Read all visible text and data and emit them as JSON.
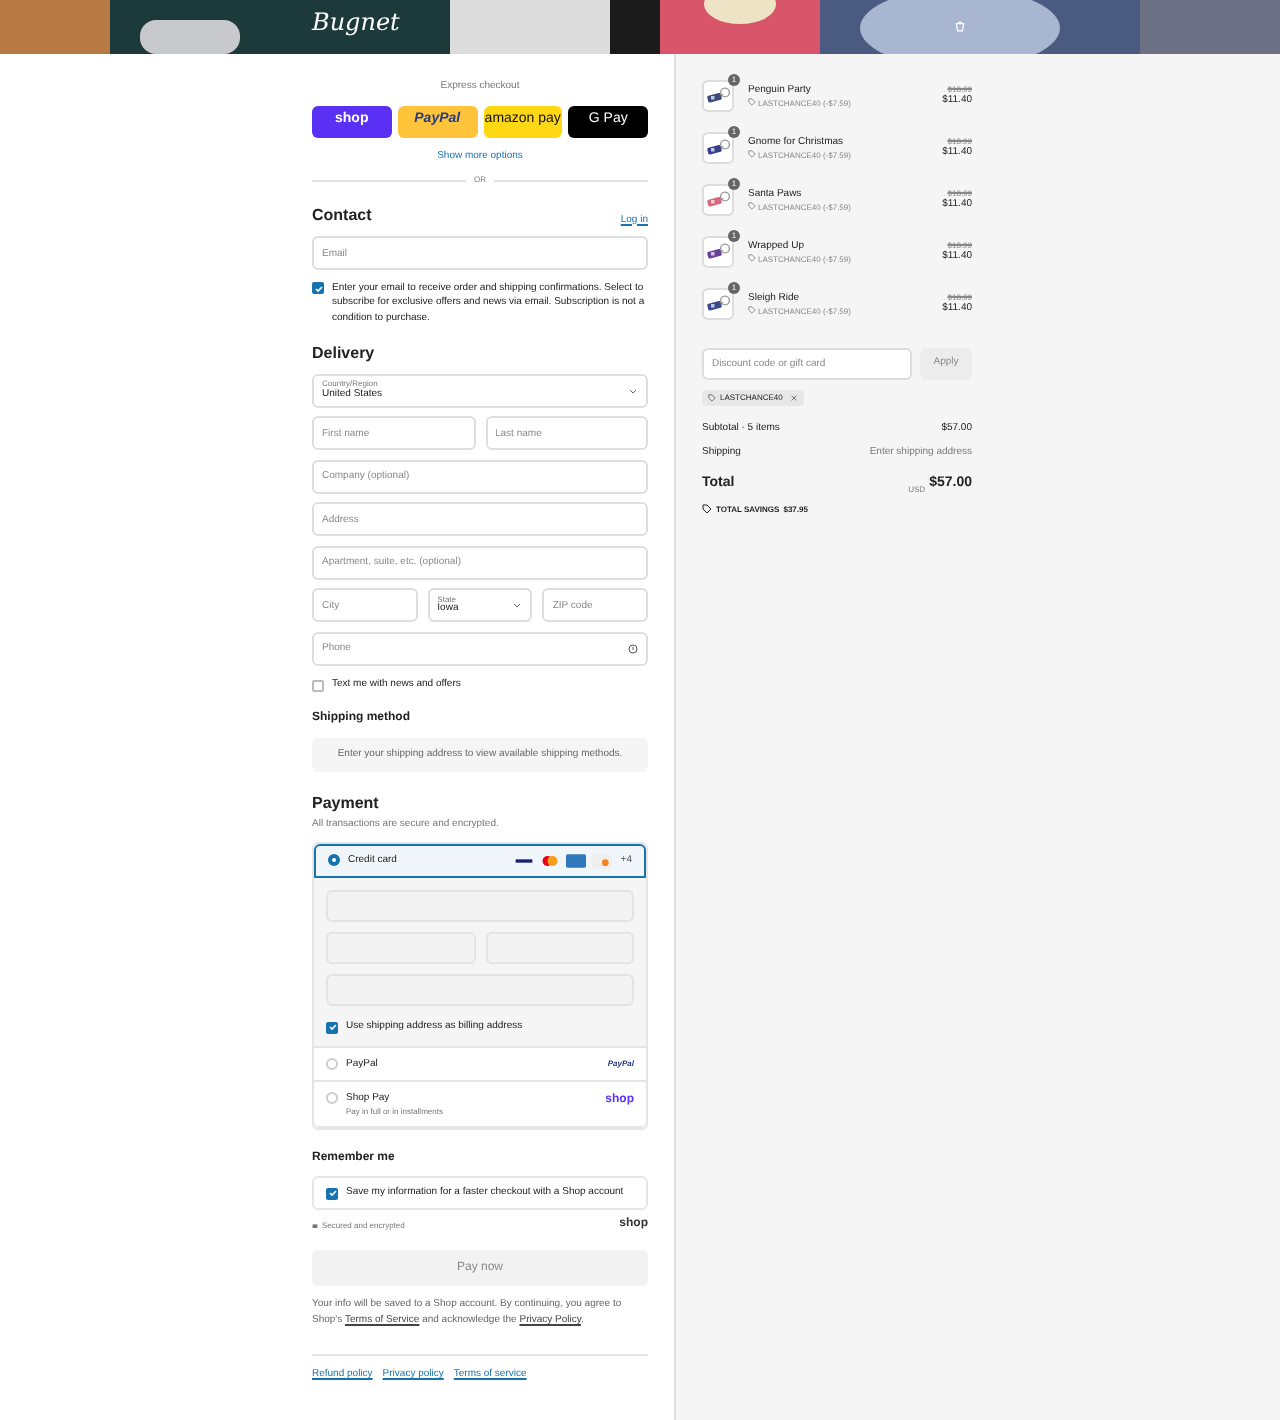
{
  "header": {
    "logo": "Bugnet"
  },
  "express": {
    "label": "Express checkout",
    "buttons": [
      {
        "kind": "shop",
        "label": "shop"
      },
      {
        "kind": "paypal",
        "label": "PayPal"
      },
      {
        "kind": "amazon",
        "label": "amazon pay"
      },
      {
        "kind": "gpay",
        "label": "G Pay"
      }
    ],
    "more": "Show more options",
    "or": "OR"
  },
  "contact": {
    "title": "Contact",
    "login": "Log in",
    "email": {
      "placeholder": "Email"
    },
    "subscribe": {
      "checked": true,
      "text": "Enter your email to receive order and shipping confirmations. Select to subscribe for exclusive offers and news via email. Subscription is not a condition to purchase."
    }
  },
  "delivery": {
    "title": "Delivery",
    "rows": [
      [
        {
          "kind": "select",
          "label": "Country/Region",
          "value": "United States"
        }
      ],
      [
        {
          "kind": "text",
          "placeholder": "First name"
        },
        {
          "kind": "text",
          "placeholder": "Last name"
        }
      ],
      [
        {
          "kind": "text",
          "placeholder": "Company (optional)"
        }
      ],
      [
        {
          "kind": "text",
          "placeholder": "Address"
        }
      ],
      [
        {
          "kind": "text",
          "placeholder": "Apartment, suite, etc. (optional)"
        }
      ],
      [
        {
          "kind": "text",
          "placeholder": "City"
        },
        {
          "kind": "select",
          "label": "State",
          "value": "Iowa"
        },
        {
          "kind": "text",
          "placeholder": "ZIP code"
        }
      ],
      [
        {
          "kind": "phone",
          "placeholder": "Phone"
        }
      ]
    ],
    "sms": {
      "checked": false,
      "text": "Text me with news and offers"
    }
  },
  "shipping": {
    "title": "Shipping method",
    "note": "Enter your shipping address to view available shipping methods."
  },
  "payment": {
    "title": "Payment",
    "subtitle": "All transactions are secure and encrypted.",
    "methods": [
      {
        "kind": "card",
        "label": "Credit card",
        "selected": true,
        "more": "+4",
        "billing": {
          "checked": true,
          "text": "Use shipping address as billing address"
        }
      },
      {
        "kind": "paypal",
        "label": "PayPal",
        "logo": "PayPal",
        "selected": false
      },
      {
        "kind": "shoppay",
        "label": "Shop Pay",
        "sub": "Pay in full or in installments",
        "logo": "shop",
        "selected": false
      }
    ]
  },
  "remember": {
    "title": "Remember me",
    "save": {
      "checked": true,
      "text": "Save my information for a faster checkout with a Shop account"
    },
    "secure": "Secured and encrypted",
    "logo": "shop"
  },
  "pay": {
    "label": "Pay now",
    "disabled": true
  },
  "info": "Your info will be saved to a Shop account. By continuing, you agree to Shop's",
  "info_link1": "Terms of Service",
  "info_mid": "and acknowledge the",
  "info_link2": "Privacy Policy",
  "info_end": ".",
  "footer_links": [
    "Refund policy",
    "Privacy policy",
    "Terms of service"
  ],
  "summary": {
    "items": [
      {
        "name": "Penguin Party",
        "discount": "LASTCHANCE40 (-$7.59)",
        "original": "$18.99",
        "price": "$11.40",
        "qty": "1"
      },
      {
        "name": "Gnome for Christmas",
        "discount": "LASTCHANCE40 (-$7.59)",
        "original": "$18.99",
        "price": "$11.40",
        "qty": "1"
      },
      {
        "name": "Santa Paws",
        "discount": "LASTCHANCE40 (-$7.59)",
        "original": "$18.99",
        "price": "$11.40",
        "qty": "1"
      },
      {
        "name": "Wrapped Up",
        "discount": "LASTCHANCE40 (-$7.59)",
        "original": "$18.99",
        "price": "$11.40",
        "qty": "1"
      },
      {
        "name": "Sleigh Ride",
        "discount": "LASTCHANCE40 (-$7.59)",
        "original": "$18.99",
        "price": "$11.40",
        "qty": "1"
      }
    ],
    "code": {
      "placeholder": "Discount code or gift card"
    },
    "apply": "Apply",
    "tag": "LASTCHANCE40",
    "subtotal_label": "Subtotal · 5 items",
    "subtotal": "$57.00",
    "shipping_label": "Shipping",
    "shipping": "Enter shipping address",
    "total_label": "Total",
    "currency": "USD",
    "total": "$57.00",
    "savings_label": "TOTAL SAVINGS",
    "savings": "$37.95"
  }
}
